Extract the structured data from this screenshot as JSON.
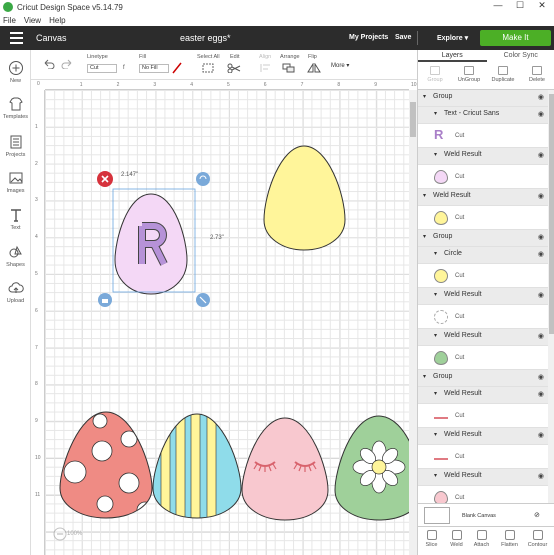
{
  "window": {
    "title": "Cricut Design Space  v5.14.79",
    "min": "—",
    "max": "☐",
    "close": "✕"
  },
  "menu": [
    "File",
    "View",
    "Help"
  ],
  "header": {
    "canvas_label": "Canvas",
    "project_name": "easter eggs*",
    "my_projects": "My Projects",
    "save": "Save",
    "explore": "Explore",
    "make_it": "Make It"
  },
  "toolbar": {
    "linetype_label": "Linetype",
    "linetype_value": "Cut",
    "fill_label": "Fill",
    "fill_value": "No Fill",
    "select_all": "Select All",
    "edit": "Edit",
    "align": "Align",
    "arrange": "Arrange",
    "flip": "Flip",
    "more": "More"
  },
  "nav": [
    "New",
    "Templates",
    "Projects",
    "Images",
    "Text",
    "Shapes",
    "Upload"
  ],
  "ruler": {
    "top": [
      "1",
      "2",
      "3",
      "4",
      "5",
      "6",
      "7",
      "8",
      "9",
      "10"
    ],
    "left": [
      "1",
      "2",
      "3",
      "4",
      "5",
      "6",
      "7",
      "8",
      "9",
      "10",
      "11"
    ]
  },
  "selection": {
    "width": "2.147\"",
    "height": "2.73\"",
    "letter": "R"
  },
  "zoom": "100%",
  "panel": {
    "tabs": [
      "Layers",
      "Color Sync"
    ],
    "tools": [
      "Group",
      "UnGroup",
      "Duplicate",
      "Delete"
    ],
    "rows": [
      {
        "kind": "head",
        "label": "Group",
        "indent": 0
      },
      {
        "kind": "head",
        "label": "Text - Cricut Sans",
        "indent": 1
      },
      {
        "kind": "item",
        "cut": "Cut",
        "swatch": "R",
        "color": "#a97fc8"
      },
      {
        "kind": "head",
        "label": "Weld Result",
        "indent": 1
      },
      {
        "kind": "item",
        "cut": "Cut",
        "swatch": "egg",
        "color": "#f4d8f6"
      },
      {
        "kind": "head",
        "label": "Weld Result",
        "indent": 0
      },
      {
        "kind": "item",
        "cut": "Cut",
        "swatch": "egg",
        "color": "#fff59a"
      },
      {
        "kind": "head",
        "label": "Group",
        "indent": 0
      },
      {
        "kind": "head",
        "label": "Circle",
        "indent": 1
      },
      {
        "kind": "item",
        "cut": "Cut",
        "swatch": "circle",
        "color": "#fff59a"
      },
      {
        "kind": "head",
        "label": "Weld Result",
        "indent": 1
      },
      {
        "kind": "item",
        "cut": "Cut",
        "swatch": "flower",
        "color": "#ffffff"
      },
      {
        "kind": "head",
        "label": "Weld Result",
        "indent": 1
      },
      {
        "kind": "item",
        "cut": "Cut",
        "swatch": "egg",
        "color": "#9fd09a"
      },
      {
        "kind": "head",
        "label": "Group",
        "indent": 0
      },
      {
        "kind": "head",
        "label": "Weld Result",
        "indent": 1
      },
      {
        "kind": "item",
        "cut": "Cut",
        "swatch": "lash",
        "color": "#e07a82"
      },
      {
        "kind": "head",
        "label": "Weld Result",
        "indent": 1
      },
      {
        "kind": "item",
        "cut": "Cut",
        "swatch": "lash",
        "color": "#e07a82"
      },
      {
        "kind": "head",
        "label": "Weld Result",
        "indent": 1
      },
      {
        "kind": "item",
        "cut": "Cut",
        "swatch": "egg",
        "color": "#f8c8cf"
      }
    ],
    "blank_canvas": "Blank Canvas",
    "bottom": [
      "Slice",
      "Weld",
      "Attach",
      "Flatten",
      "Contour"
    ]
  },
  "colors": {
    "accent": "#4caf26",
    "header": "#2c2c2c",
    "egg_purple": "#f4d8f6",
    "egg_yellow": "#fff59a",
    "egg_red": "#ef8b84",
    "egg_pink": "#f8c8cf",
    "egg_green": "#9fd09a",
    "egg_blue": "#8fdcea"
  }
}
